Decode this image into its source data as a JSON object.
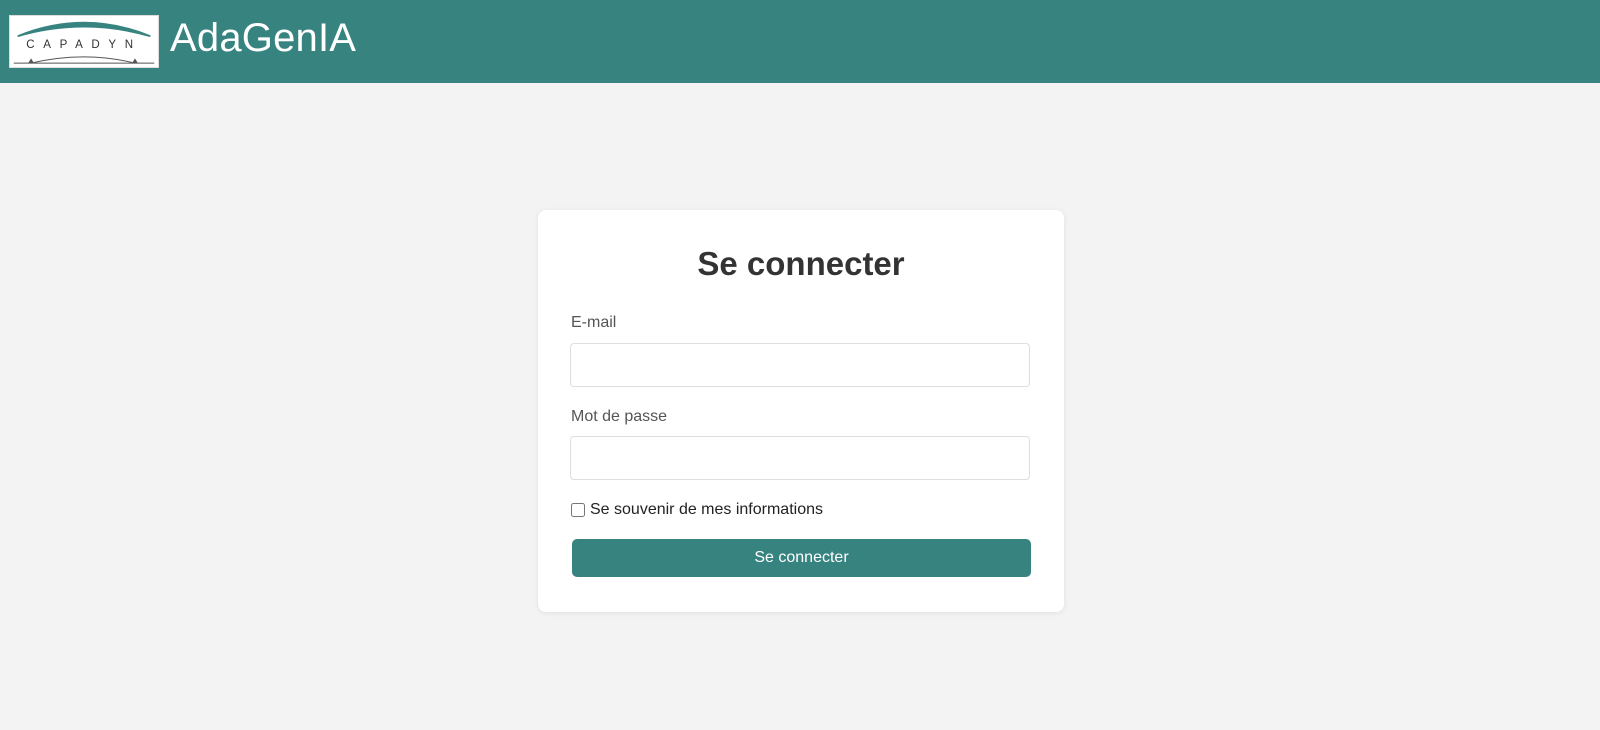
{
  "header": {
    "logo_text": "CAPADYN",
    "app_title": "AdaGenIA"
  },
  "login": {
    "title": "Se connecter",
    "email_label": "E-mail",
    "email_value": "",
    "password_label": "Mot de passe",
    "password_value": "",
    "remember_label": "Se souvenir de mes informations",
    "remember_checked": false,
    "submit_label": "Se connecter"
  },
  "colors": {
    "brand": "#378380",
    "page_background": "#f3f3f3",
    "card_background": "#ffffff"
  }
}
